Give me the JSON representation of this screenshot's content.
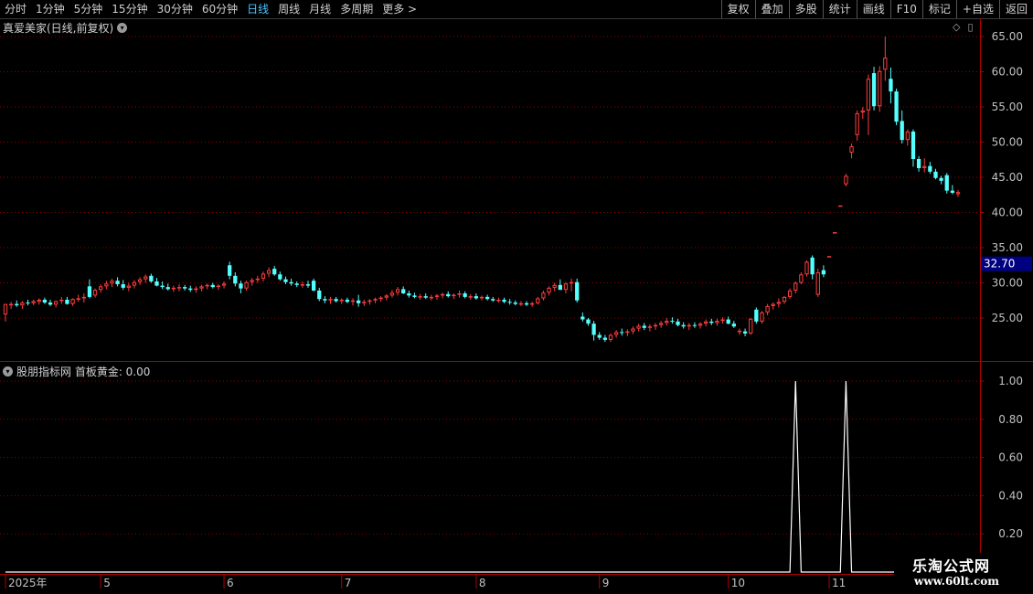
{
  "toolbar": {
    "periods": [
      "分时",
      "1分钟",
      "5分钟",
      "15分钟",
      "30分钟",
      "60分钟",
      "日线",
      "周线",
      "月线",
      "多周期",
      "更多 >"
    ],
    "active_period": "日线",
    "tools": [
      "复权",
      "叠加",
      "多股",
      "统计",
      "画线",
      "F10",
      "标记",
      "+自选",
      "返回"
    ]
  },
  "stock": {
    "title": "真爱美家(日线,前复权)"
  },
  "indicator": {
    "title": "股朋指标网 首板黄金: 0.00"
  },
  "price_marker": "32.70",
  "watermark": {
    "line1": "乐淘公式网",
    "line2": "www.60lt.com"
  },
  "colors": {
    "up": "#ff3d3d",
    "down": "#54ffff",
    "grid": "#8b0000",
    "axis": "#b00000",
    "marker_bg": "#000080"
  },
  "chart_data": [
    {
      "type": "candlestick",
      "title": "真爱美家(日线,前复权)",
      "y_ticks": [
        "65.00",
        "60.00",
        "55.00",
        "50.00",
        "45.00",
        "40.00",
        "35.00",
        "30.00",
        "25.00"
      ],
      "ylim": [
        20.5,
        66.5
      ],
      "x_ticks": [
        "2025年",
        "5",
        "6",
        "7",
        "8",
        "9",
        "10",
        "11"
      ],
      "x_tick_index": [
        0,
        17,
        39,
        60,
        84,
        106,
        129,
        147
      ],
      "last_price": 32.7,
      "candles": [
        [
          25.5,
          27.0,
          24.5,
          27.0
        ],
        [
          26.8,
          27.3,
          26.3,
          27.0
        ],
        [
          27.0,
          27.5,
          26.6,
          26.8
        ],
        [
          26.8,
          27.4,
          26.3,
          27.2
        ],
        [
          27.2,
          27.6,
          26.8,
          27.1
        ],
        [
          27.1,
          27.6,
          26.8,
          27.4
        ],
        [
          27.3,
          27.8,
          26.9,
          27.6
        ],
        [
          27.6,
          27.9,
          27.0,
          27.2
        ],
        [
          27.2,
          27.6,
          26.7,
          26.9
        ],
        [
          26.9,
          27.5,
          26.5,
          27.4
        ],
        [
          27.4,
          28.0,
          27.0,
          27.6
        ],
        [
          27.6,
          28.0,
          26.9,
          27.0
        ],
        [
          27.0,
          27.8,
          26.7,
          27.7
        ],
        [
          27.7,
          28.3,
          27.3,
          27.8
        ],
        [
          27.8,
          28.5,
          27.2,
          28.0
        ],
        [
          29.5,
          30.5,
          27.8,
          28.0
        ],
        [
          28.2,
          29.2,
          27.9,
          29.0
        ],
        [
          29.0,
          29.8,
          28.6,
          29.5
        ],
        [
          29.5,
          30.3,
          29.1,
          29.9
        ],
        [
          29.9,
          30.6,
          29.4,
          30.3
        ],
        [
          30.3,
          30.8,
          29.5,
          29.8
        ],
        [
          29.8,
          30.4,
          29.0,
          29.3
        ],
        [
          29.3,
          30.0,
          28.8,
          29.6
        ],
        [
          29.6,
          30.4,
          29.2,
          30.1
        ],
        [
          30.1,
          30.8,
          29.7,
          30.5
        ],
        [
          30.5,
          31.2,
          30.0,
          30.9
        ],
        [
          31.0,
          31.3,
          30.0,
          30.2
        ],
        [
          30.2,
          30.7,
          29.5,
          29.6
        ],
        [
          29.6,
          30.2,
          29.1,
          29.4
        ],
        [
          29.4,
          29.9,
          28.9,
          29.1
        ],
        [
          29.1,
          29.6,
          28.7,
          29.3
        ],
        [
          29.3,
          29.8,
          28.8,
          29.4
        ],
        [
          29.4,
          29.7,
          28.9,
          29.2
        ],
        [
          29.2,
          29.6,
          28.7,
          29.0
        ],
        [
          29.0,
          29.5,
          28.6,
          29.2
        ],
        [
          29.2,
          29.7,
          28.8,
          29.5
        ],
        [
          29.5,
          29.9,
          29.1,
          29.7
        ],
        [
          29.7,
          30.0,
          29.2,
          29.4
        ],
        [
          29.4,
          29.8,
          29.0,
          29.6
        ],
        [
          29.6,
          30.2,
          29.2,
          29.9
        ],
        [
          32.5,
          33.0,
          30.5,
          31.0
        ],
        [
          31.0,
          31.5,
          29.5,
          29.9
        ],
        [
          29.9,
          30.3,
          28.5,
          29.2
        ],
        [
          29.2,
          30.3,
          28.9,
          30.1
        ],
        [
          30.1,
          30.7,
          29.6,
          30.4
        ],
        [
          30.4,
          31.0,
          30.0,
          30.6
        ],
        [
          30.6,
          31.6,
          30.2,
          31.3
        ],
        [
          31.3,
          32.2,
          30.8,
          31.8
        ],
        [
          32.0,
          32.4,
          31.0,
          31.2
        ],
        [
          31.2,
          31.6,
          30.3,
          30.5
        ],
        [
          30.5,
          30.9,
          29.8,
          30.1
        ],
        [
          30.1,
          30.6,
          29.6,
          29.9
        ],
        [
          29.9,
          30.2,
          29.4,
          29.7
        ],
        [
          29.7,
          30.2,
          29.3,
          29.8
        ],
        [
          29.8,
          30.3,
          29.3,
          29.6
        ],
        [
          30.3,
          30.6,
          28.8,
          28.9
        ],
        [
          28.9,
          29.3,
          27.4,
          27.7
        ],
        [
          27.7,
          28.1,
          27.1,
          27.5
        ],
        [
          27.5,
          28.0,
          27.0,
          27.7
        ],
        [
          27.7,
          28.0,
          27.2,
          27.4
        ],
        [
          27.4,
          27.8,
          27.0,
          27.6
        ],
        [
          27.6,
          27.9,
          27.1,
          27.3
        ],
        [
          27.3,
          27.8,
          26.8,
          27.5
        ],
        [
          27.5,
          28.3,
          26.6,
          27.1
        ],
        [
          27.1,
          27.6,
          26.7,
          27.3
        ],
        [
          27.3,
          27.7,
          26.9,
          27.5
        ],
        [
          27.5,
          27.9,
          27.1,
          27.7
        ],
        [
          27.7,
          28.1,
          27.3,
          27.9
        ],
        [
          27.9,
          28.4,
          27.5,
          28.2
        ],
        [
          28.2,
          29.0,
          27.9,
          28.6
        ],
        [
          28.6,
          29.4,
          28.2,
          29.1
        ],
        [
          29.1,
          29.5,
          28.4,
          28.5
        ],
        [
          28.5,
          28.9,
          27.9,
          28.2
        ],
        [
          28.2,
          28.6,
          27.8,
          28.0
        ],
        [
          28.0,
          28.4,
          27.6,
          28.1
        ],
        [
          28.1,
          28.5,
          27.7,
          27.9
        ],
        [
          27.9,
          28.3,
          27.5,
          28.0
        ],
        [
          28.0,
          28.4,
          27.6,
          28.2
        ],
        [
          28.2,
          28.6,
          27.8,
          28.4
        ],
        [
          28.4,
          28.8,
          27.9,
          28.1
        ],
        [
          28.1,
          28.5,
          27.7,
          28.3
        ],
        [
          28.3,
          28.9,
          27.9,
          28.5
        ],
        [
          28.5,
          28.8,
          27.8,
          28.0
        ],
        [
          28.0,
          28.4,
          27.6,
          28.1
        ],
        [
          28.1,
          28.5,
          27.6,
          27.8
        ],
        [
          27.8,
          28.2,
          27.5,
          28.0
        ],
        [
          28.0,
          28.3,
          27.5,
          27.7
        ],
        [
          27.7,
          28.0,
          27.3,
          27.5
        ],
        [
          27.5,
          27.9,
          27.2,
          27.6
        ],
        [
          27.6,
          27.9,
          27.1,
          27.3
        ],
        [
          27.3,
          27.7,
          26.9,
          27.2
        ],
        [
          27.2,
          27.5,
          26.8,
          27.0
        ],
        [
          27.0,
          27.4,
          26.7,
          27.1
        ],
        [
          27.1,
          27.4,
          26.7,
          26.9
        ],
        [
          26.9,
          27.3,
          26.6,
          27.1
        ],
        [
          27.1,
          28.0,
          26.9,
          27.8
        ],
        [
          27.8,
          28.9,
          27.5,
          28.6
        ],
        [
          28.6,
          29.5,
          28.2,
          29.3
        ],
        [
          29.3,
          30.0,
          28.8,
          29.7
        ],
        [
          29.7,
          30.5,
          29.1,
          29.0
        ],
        [
          29.0,
          30.1,
          28.5,
          29.9
        ],
        [
          29.9,
          30.6,
          28.8,
          30.1
        ],
        [
          30.1,
          30.6,
          27.2,
          27.5
        ],
        [
          25.2,
          25.8,
          24.5,
          24.8
        ],
        [
          24.8,
          25.0,
          23.9,
          24.2
        ],
        [
          24.2,
          24.6,
          21.8,
          22.6
        ],
        [
          22.6,
          23.0,
          21.9,
          22.2
        ],
        [
          22.2,
          22.6,
          21.6,
          21.9
        ],
        [
          21.9,
          22.8,
          21.6,
          22.6
        ],
        [
          22.6,
          23.3,
          22.2,
          23.0
        ],
        [
          23.0,
          23.5,
          22.5,
          22.9
        ],
        [
          22.9,
          23.4,
          22.4,
          23.1
        ],
        [
          23.1,
          23.8,
          22.7,
          23.5
        ],
        [
          23.5,
          24.2,
          23.1,
          23.9
        ],
        [
          23.9,
          24.3,
          23.3,
          23.6
        ],
        [
          23.6,
          24.1,
          23.1,
          23.8
        ],
        [
          23.8,
          24.3,
          23.3,
          24.0
        ],
        [
          24.0,
          24.6,
          23.6,
          24.3
        ],
        [
          24.3,
          25.0,
          23.9,
          24.6
        ],
        [
          24.6,
          25.1,
          24.2,
          24.5
        ],
        [
          24.5,
          24.9,
          23.8,
          24.0
        ],
        [
          24.0,
          24.4,
          23.5,
          23.8
        ],
        [
          23.8,
          24.3,
          23.3,
          24.0
        ],
        [
          24.0,
          24.4,
          23.6,
          23.9
        ],
        [
          23.9,
          24.4,
          23.5,
          24.2
        ],
        [
          24.2,
          24.8,
          23.8,
          24.5
        ],
        [
          24.5,
          24.9,
          24.0,
          24.3
        ],
        [
          24.3,
          24.9,
          23.9,
          24.6
        ],
        [
          24.6,
          25.1,
          24.2,
          24.8
        ],
        [
          24.8,
          25.2,
          24.1,
          24.2
        ],
        [
          24.2,
          24.6,
          23.6,
          23.8
        ],
        [
          23.0,
          23.5,
          22.6,
          23.2
        ],
        [
          23.1,
          23.5,
          22.4,
          22.8
        ],
        [
          22.8,
          25.0,
          22.6,
          24.9
        ],
        [
          26.2,
          26.5,
          24.2,
          24.5
        ],
        [
          24.5,
          26.0,
          24.2,
          25.8
        ],
        [
          25.8,
          27.0,
          25.4,
          26.7
        ],
        [
          26.7,
          27.2,
          26.2,
          27.0
        ],
        [
          27.0,
          27.8,
          26.5,
          27.3
        ],
        [
          27.3,
          28.1,
          27.0,
          28.0
        ],
        [
          28.0,
          29.2,
          27.7,
          28.9
        ],
        [
          28.9,
          30.2,
          28.5,
          30.0
        ],
        [
          30.0,
          31.5,
          29.8,
          31.2
        ],
        [
          31.2,
          33.2,
          30.9,
          33.0
        ],
        [
          33.6,
          33.9,
          30.5,
          31.2
        ],
        [
          28.3,
          32.0,
          28.0,
          31.5
        ],
        [
          31.8,
          32.5,
          30.8,
          31.2
        ],
        [
          33.8,
          33.8,
          33.8,
          33.8
        ],
        [
          37.2,
          37.2,
          37.2,
          37.2
        ],
        [
          41.0,
          41.0,
          41.0,
          41.0
        ],
        [
          44.0,
          45.5,
          43.7,
          45.2
        ],
        [
          48.5,
          49.8,
          47.7,
          49.4
        ],
        [
          51.0,
          54.5,
          50.2,
          54.1
        ],
        [
          54.2,
          55.0,
          53.3,
          54.5
        ],
        [
          54.5,
          59.6,
          51.0,
          59.0
        ],
        [
          59.8,
          60.7,
          54.5,
          55.1
        ],
        [
          55.1,
          60.8,
          54.3,
          60.1
        ],
        [
          60.3,
          65.0,
          58.7,
          62.0
        ],
        [
          59.0,
          60.6,
          55.5,
          57.2
        ],
        [
          57.2,
          57.6,
          52.4,
          52.9
        ],
        [
          53.0,
          54.5,
          49.8,
          50.3
        ],
        [
          50.3,
          51.8,
          49.5,
          51.5
        ],
        [
          51.5,
          51.8,
          46.5,
          47.6
        ],
        [
          47.6,
          48.0,
          45.8,
          46.3
        ],
        [
          46.3,
          47.7,
          45.7,
          46.6
        ],
        [
          46.6,
          47.2,
          45.5,
          45.8
        ],
        [
          45.8,
          46.2,
          44.7,
          44.9
        ],
        [
          44.9,
          45.2,
          44.0,
          44.5
        ],
        [
          45.3,
          45.6,
          42.7,
          43.1
        ],
        [
          43.1,
          43.9,
          42.6,
          42.8
        ],
        [
          42.6,
          43.2,
          42.2,
          42.9
        ]
      ]
    },
    {
      "type": "line",
      "title": "股朋指标网 首板黄金: 0.00",
      "y_ticks": [
        "1.00",
        "0.80",
        "0.60",
        "0.40",
        "0.20"
      ],
      "ylim": [
        -0.05,
        1.05
      ],
      "series": [
        {
          "signals_at_index": [
            141,
            150
          ],
          "value": 1.0
        }
      ]
    }
  ]
}
